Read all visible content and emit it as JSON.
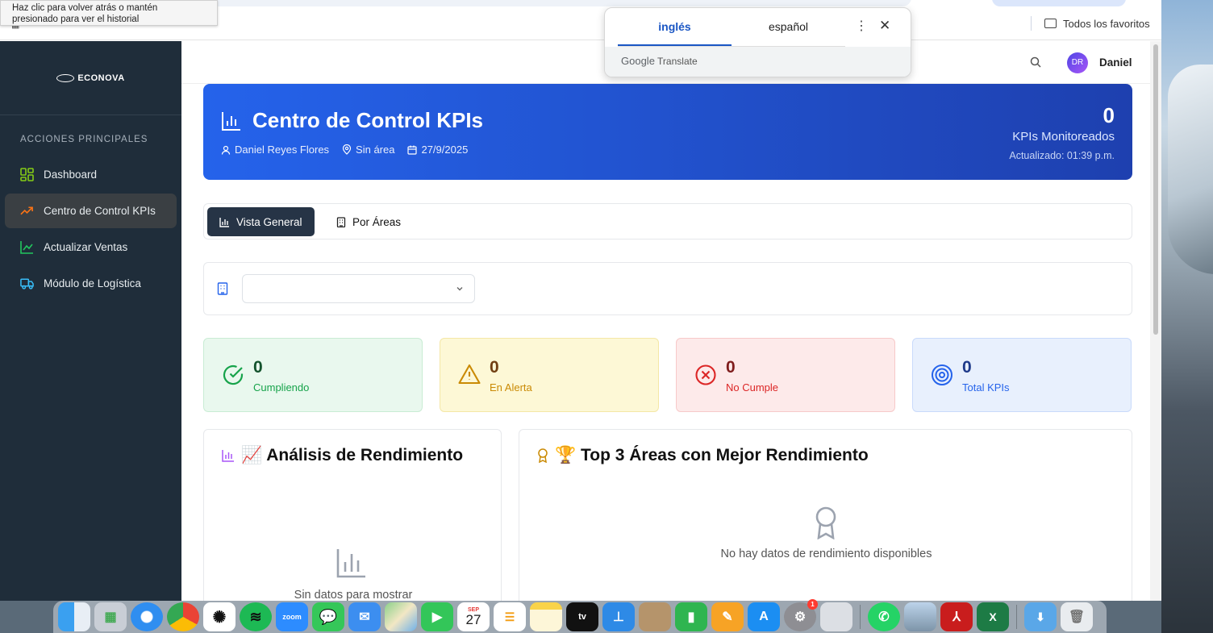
{
  "browser": {
    "tooltip": "Haz clic para volver atrás o mantén presionado para ver el historial",
    "bookmarks_label": "Todos los favoritos",
    "translate": {
      "tab_source": "inglés",
      "tab_target": "español",
      "footer_brand": "Google",
      "footer_product": "Translate"
    }
  },
  "sidebar": {
    "logo": "ECONOVA",
    "section_title": "ACCIONES PRINCIPALES",
    "items": [
      {
        "label": "Dashboard",
        "icon": "dashboard-grid-icon",
        "color": "#84cc16"
      },
      {
        "label": "Centro de Control KPIs",
        "icon": "trending-up-icon",
        "color": "#f97316",
        "active": true
      },
      {
        "label": "Actualizar Ventas",
        "icon": "line-chart-icon",
        "color": "#22c55e"
      },
      {
        "label": "Módulo de Logística",
        "icon": "truck-icon",
        "color": "#38bdf8"
      }
    ]
  },
  "topbar": {
    "avatar_initials": "DR",
    "username": "Daniel"
  },
  "hero": {
    "title": "Centro de Control KPIs",
    "user": "Daniel Reyes Flores",
    "area": "Sin área",
    "date": "27/9/2025",
    "count": "0",
    "count_label": "KPIs Monitoreados",
    "updated": "Actualizado: 01:39 p.m."
  },
  "tabs": [
    {
      "label": "Vista General",
      "active": true
    },
    {
      "label": "Por Áreas",
      "active": false
    }
  ],
  "filter": {
    "selected": ""
  },
  "stats": [
    {
      "value": "0",
      "label": "Cumpliendo",
      "icon": "check-circle-icon"
    },
    {
      "value": "0",
      "label": "En Alerta",
      "icon": "warning-triangle-icon"
    },
    {
      "value": "0",
      "label": "No Cumple",
      "icon": "x-circle-icon"
    },
    {
      "value": "0",
      "label": "Total KPIs",
      "icon": "target-icon"
    }
  ],
  "panels": {
    "analysis": {
      "title": "📈 Análisis de Rendimiento",
      "empty": "Sin datos para mostrar"
    },
    "top": {
      "title": "🏆 Top 3 Áreas con Mejor Rendimiento",
      "empty": "No hay datos de rendimiento disponibles"
    }
  },
  "dock": {
    "calendar_month": "SEP",
    "calendar_day": "27",
    "settings_badge": "1",
    "apps": [
      "Finder",
      "Launchpad",
      "Safari",
      "Chrome",
      "ChatGPT",
      "Spotify",
      "Zoom",
      "Messages",
      "Mail",
      "Maps",
      "FaceTime",
      "Calendar",
      "Reminders",
      "Notes",
      "TV",
      "Keynote",
      "Contacts",
      "Numbers",
      "Pages",
      "App Store",
      "System Settings",
      "iPhone Mirroring",
      "WhatsApp",
      "Preview",
      "Acrobat",
      "Excel",
      "Downloads",
      "Trash"
    ]
  }
}
